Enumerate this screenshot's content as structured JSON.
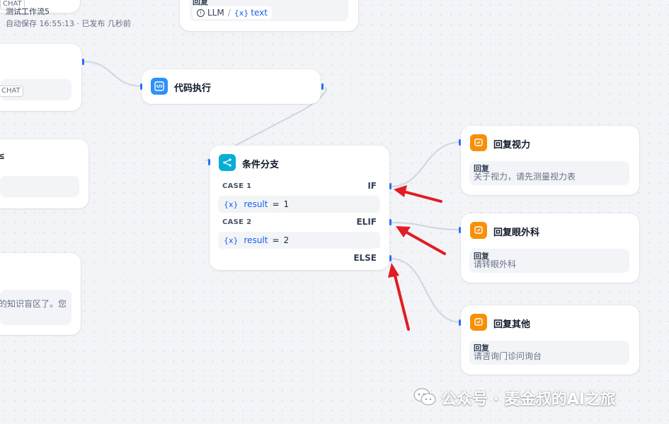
{
  "workflow": {
    "name_partial": "测试工作流5",
    "autosave": "自动保存 16:55:13 · 已发布 几秒前",
    "chat_tag_top": "CHAT"
  },
  "partial_nodes": {
    "chat_tag_mid": "CHAT",
    "left_text_fragment": "的知识盲区了。您",
    "top_reply_label": "回复",
    "llm_chip": "LLM",
    "text_var": "text",
    "var_icon": "{x}"
  },
  "code_node": {
    "title": "代码执行",
    "icon": "code-icon"
  },
  "if_node": {
    "title": "条件分支",
    "icon": "branch-icon",
    "case1_label": "CASE 1",
    "if_label": "IF",
    "case1_var": "result",
    "case1_op": "=",
    "case1_val": "1",
    "case2_label": "CASE 2",
    "elif_label": "ELIF",
    "case2_var": "result",
    "case2_op": "=",
    "case2_val": "2",
    "else_label": "ELSE"
  },
  "reply_nodes": [
    {
      "title": "回复视力",
      "label": "回复",
      "text": "关于视力，请先测量视力表"
    },
    {
      "title": "回复眼外科",
      "label": "回复",
      "text": "请转眼外科"
    },
    {
      "title": "回复其他",
      "label": "回复",
      "text": "请咨询门诊问询台"
    }
  ],
  "watermark": "公众号 · 麦金叔的AI之旅",
  "colors": {
    "handle": "#2970ff",
    "code_icon_bg": "#2e90fa",
    "if_icon_bg": "#06aed4",
    "reply_icon_bg": "#f79009",
    "annotation_arrow": "#e31b23"
  }
}
